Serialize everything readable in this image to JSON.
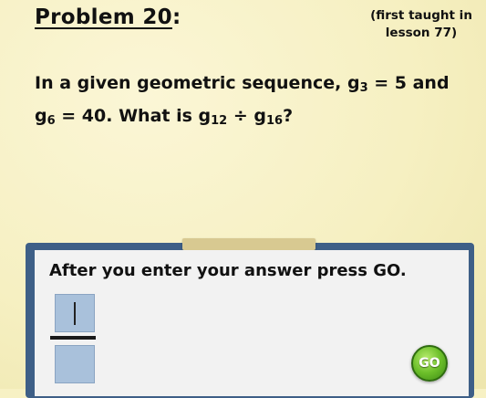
{
  "problem": {
    "title": "Problem 20",
    "title_suffix": ":",
    "note_line1": "(first taught in",
    "note_line2": "lesson 77)"
  },
  "question": {
    "part1": "In a given geometric sequence, g",
    "sub1": "3",
    "part2": " = 5 and g",
    "sub2": "6",
    "part3": " = 40. What is g",
    "sub3": "12",
    "part4": " ÷ g",
    "sub4": "16",
    "part5": "?"
  },
  "answer_panel": {
    "prompt": "After you enter your answer press GO.",
    "go_label": "GO",
    "numerator_value": "",
    "denominator_value": ""
  },
  "colors": {
    "paper": "#f7f1c4",
    "panel_border": "#3e5f87",
    "input_box": "#a9c1db",
    "go_button": "#6cbf2a"
  }
}
